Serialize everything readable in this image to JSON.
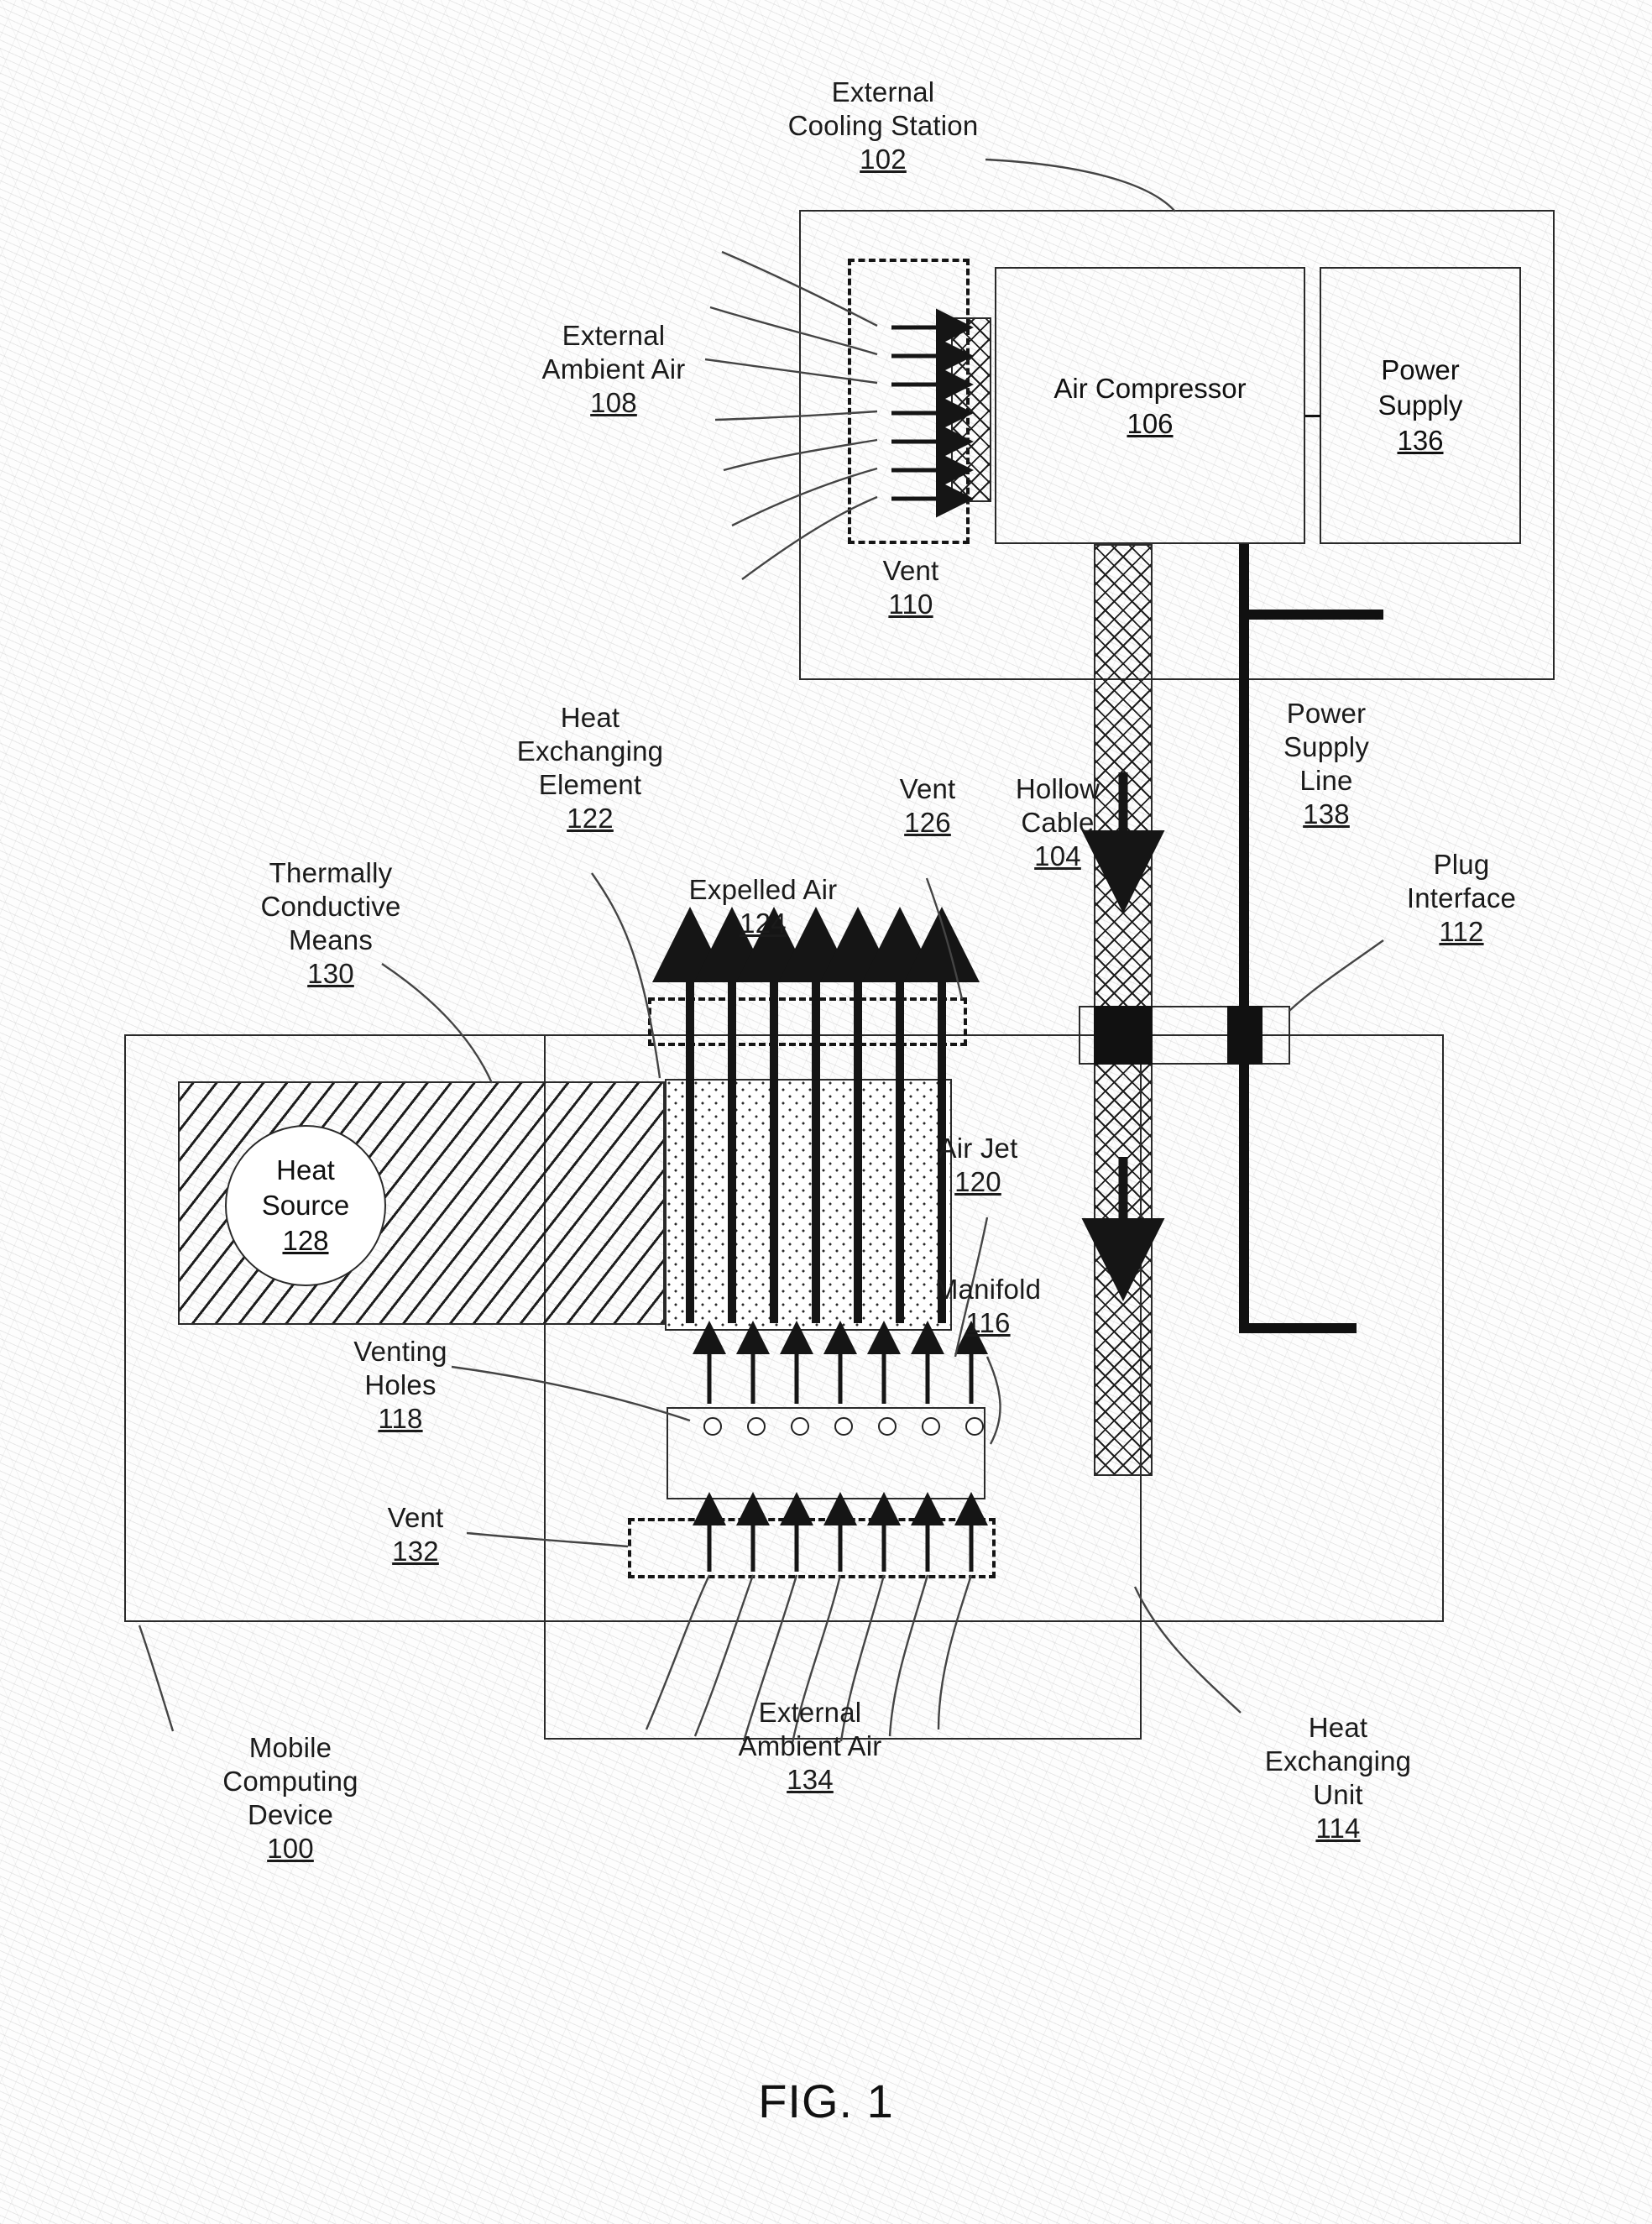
{
  "figure": {
    "caption": "FIG. 1"
  },
  "labels": {
    "external_cooling_station": {
      "lines": [
        "External",
        "Cooling Station"
      ],
      "num": "102"
    },
    "external_ambient_air_108": {
      "lines": [
        "External",
        "Ambient Air"
      ],
      "num": "108"
    },
    "vent_110": {
      "lines": [
        "Vent"
      ],
      "num": "110"
    },
    "air_compressor": {
      "lines": [
        "Air Compressor"
      ],
      "num": "106"
    },
    "power_supply": {
      "lines": [
        "Power",
        "Supply"
      ],
      "num": "136"
    },
    "heat_exchanging_element": {
      "lines": [
        "Heat",
        "Exchanging",
        "Element"
      ],
      "num": "122"
    },
    "expelled_air": {
      "lines": [
        "Expelled Air"
      ],
      "num": "124"
    },
    "vent_126": {
      "lines": [
        "Vent"
      ],
      "num": "126"
    },
    "hollow_cable": {
      "lines": [
        "Hollow",
        "Cable"
      ],
      "num": "104"
    },
    "power_supply_line": {
      "lines": [
        "Power",
        "Supply",
        "Line"
      ],
      "num": "138"
    },
    "plug_interface": {
      "lines": [
        "Plug",
        "Interface"
      ],
      "num": "112"
    },
    "thermally_conductive_means": {
      "lines": [
        "Thermally",
        "Conductive",
        "Means"
      ],
      "num": "130"
    },
    "heat_source": {
      "lines": [
        "Heat",
        "Source"
      ],
      "num": "128"
    },
    "air_jet": {
      "lines": [
        "Air Jet"
      ],
      "num": "120"
    },
    "manifold": {
      "lines": [
        "Manifold"
      ],
      "num": "116"
    },
    "venting_holes": {
      "lines": [
        "Venting",
        "Holes"
      ],
      "num": "118"
    },
    "vent_132": {
      "lines": [
        "Vent"
      ],
      "num": "132"
    },
    "mobile_computing_device": {
      "lines": [
        "Mobile",
        "Computing",
        "Device"
      ],
      "num": "100"
    },
    "external_ambient_air_134": {
      "lines": [
        "External",
        "Ambient Air"
      ],
      "num": "134"
    },
    "heat_exchanging_unit": {
      "lines": [
        "Heat",
        "Exchanging",
        "Unit"
      ],
      "num": "114"
    }
  },
  "counts": {
    "vent_110_arrows": 7,
    "expelled_air_arrows": 7,
    "venting_holes": 7,
    "air_jet_arrows": 7,
    "ambient_intake_arrows": 7
  },
  "colors": {
    "line": "#2a2a2a",
    "ink": "#111111",
    "paper": "#fdfdfd"
  }
}
